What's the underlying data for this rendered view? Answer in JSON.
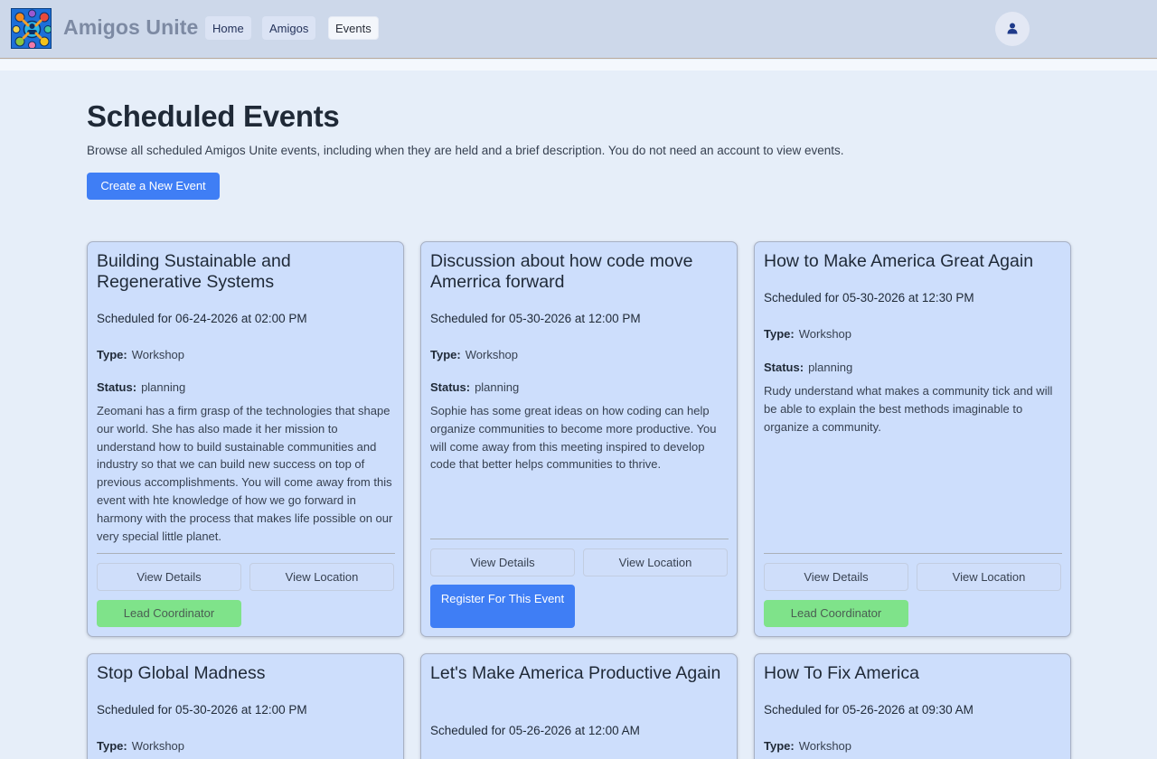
{
  "header": {
    "brand": "Amigos Unite",
    "nav": [
      "Home",
      "Amigos",
      "Events"
    ],
    "active_nav": "Events"
  },
  "page": {
    "title": "Scheduled Events",
    "description": "Browse all scheduled Amigos Unite events, including when they are held and a brief description. You do not need an account to view events.",
    "create_button": "Create a New Event"
  },
  "labels": {
    "type": "Type:",
    "status": "Status:",
    "view_details": "View Details",
    "view_location": "View Location",
    "lead_coordinator": "Lead Coordinator",
    "register": "Register For This Event"
  },
  "events": [
    {
      "title": "Building Sustainable and Regenerative Systems",
      "scheduled": "Scheduled for 06-24-2026 at 02:00 PM",
      "type": "Workshop",
      "status": "planning",
      "description": "Zeomani has a firm grasp of the technologies that shape our world. She has also made it her mission to understand how to build sustainable communities and industry so that we can build new success on top of previous accomplishments. You will come away from this event with hte knowledge of how we go forward in harmony with the process that makes life possible on our very special little planet."
    },
    {
      "title": "Discussion about how code move Amerrica forward",
      "scheduled": "Scheduled for 05-30-2026 at 12:00 PM",
      "type": "Workshop",
      "status": "planning",
      "description": "Sophie has some great ideas on how coding can help organize communities to become more productive. You will come away from this meeting inspired to develop code that better helps communities to thrive."
    },
    {
      "title": "How to Make America Great Again",
      "scheduled": "Scheduled for 05-30-2026 at 12:30 PM",
      "type": "Workshop",
      "status": "planning",
      "description": "Rudy understand what makes a community tick and will be able to explain the best methods imaginable to organize a community."
    },
    {
      "title": "Stop Global Madness",
      "scheduled": "Scheduled for 05-30-2026 at 12:00 PM",
      "type": "Workshop"
    },
    {
      "title": "Let's Make America Productive Again",
      "scheduled": "Scheduled for 05-26-2026 at 12:00 AM"
    },
    {
      "title": "How To Fix America",
      "scheduled": "Scheduled for 05-26-2026 at 09:30 AM",
      "type": "Workshop"
    }
  ]
}
